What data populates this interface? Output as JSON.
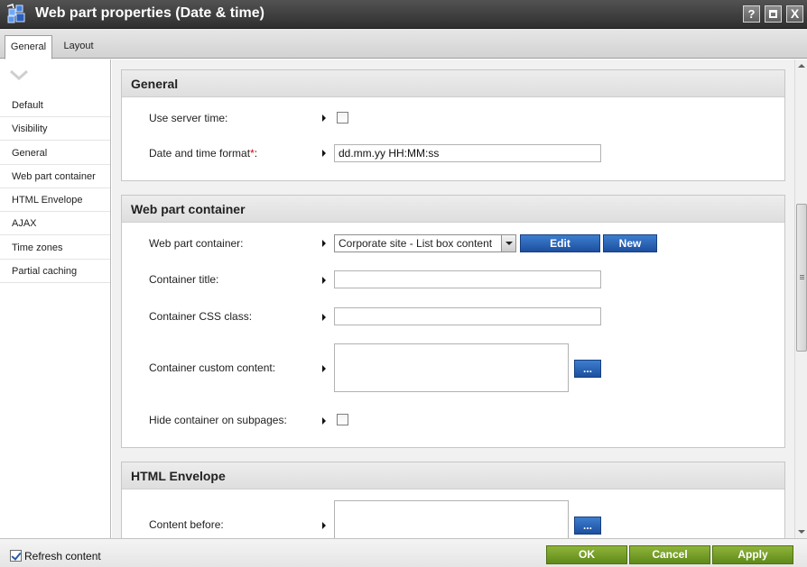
{
  "window": {
    "title": "Web part properties (Date & time)",
    "help_label": "?",
    "close_label": "X"
  },
  "tabs": [
    {
      "label": "General",
      "active": true
    },
    {
      "label": "Layout",
      "active": false
    }
  ],
  "nav": {
    "items": [
      {
        "label": "Default"
      },
      {
        "label": "Visibility"
      },
      {
        "label": "General"
      },
      {
        "label": "Web part container"
      },
      {
        "label": "HTML Envelope"
      },
      {
        "label": "AJAX"
      },
      {
        "label": "Time zones"
      },
      {
        "label": "Partial caching"
      }
    ]
  },
  "sections": {
    "general": {
      "title": "General",
      "use_server_time_label": "Use server time:",
      "use_server_time_checked": false,
      "date_format_label": "Date and time format",
      "required_marker": "*",
      "date_format_colon": ":",
      "date_format_value": "dd.mm.yy HH:MM:ss"
    },
    "container": {
      "title": "Web part container",
      "container_label": "Web part container:",
      "container_value": "Corporate site - List box content",
      "edit_label": "Edit",
      "new_label": "New",
      "container_title_label": "Container title:",
      "container_title_value": "",
      "css_class_label": "Container CSS class:",
      "css_class_value": "",
      "custom_content_label": "Container custom content:",
      "custom_content_value": "",
      "ellipsis_label": "...",
      "hide_label": "Hide container on subpages:",
      "hide_checked": false
    },
    "envelope": {
      "title": "HTML Envelope",
      "content_before_label": "Content before:",
      "content_before_value": "",
      "ellipsis_label": "..."
    }
  },
  "footer": {
    "refresh_label": "Refresh content",
    "refresh_checked": true,
    "ok_label": "OK",
    "cancel_label": "Cancel",
    "apply_label": "Apply"
  },
  "colors": {
    "titlebar": "#3f3f3f",
    "blue_button": "#2a63b8",
    "green_button": "#76a12a"
  }
}
